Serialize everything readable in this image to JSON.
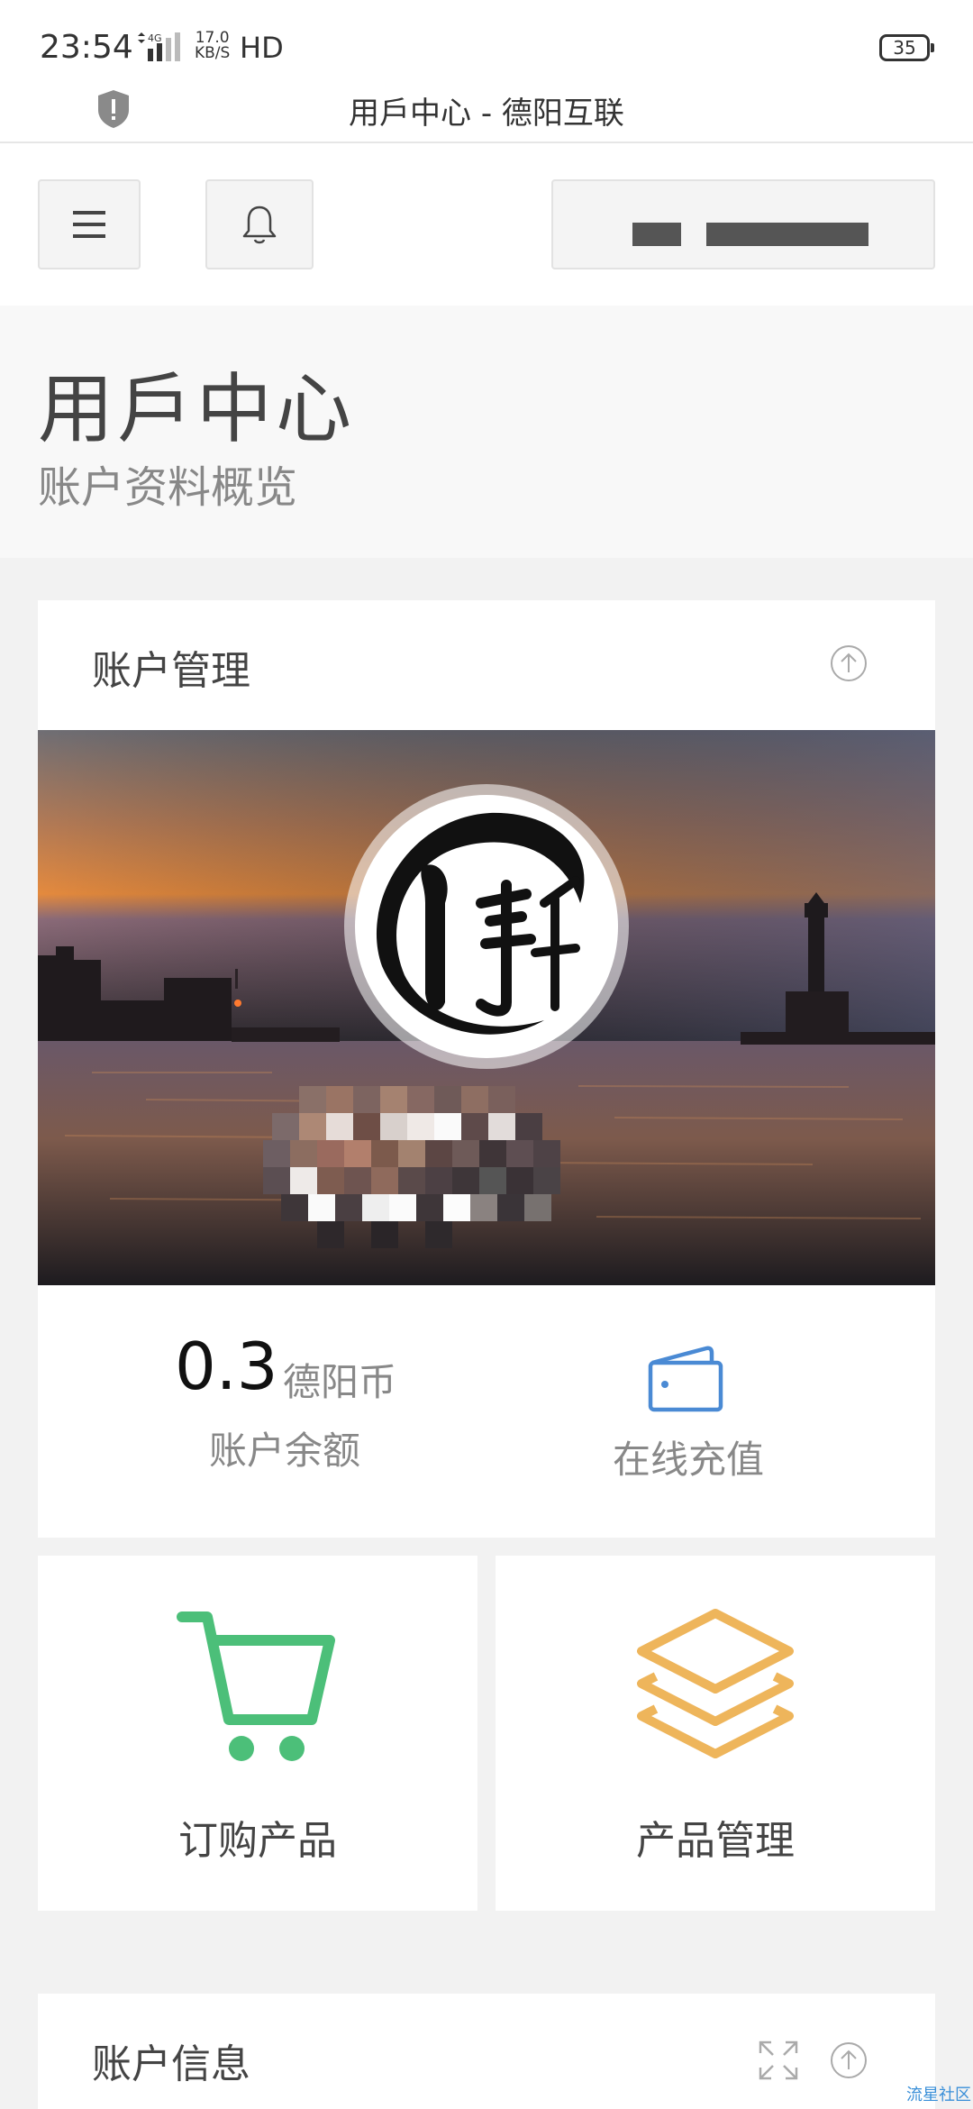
{
  "status_bar": {
    "time": "23:54",
    "network": "4G",
    "speed_value": "17.0",
    "speed_unit": "KB/S",
    "hd": "HD",
    "battery": "35"
  },
  "browser": {
    "title": "用戶中心 - 德阳互联"
  },
  "page": {
    "title": "用戶中心",
    "subtitle": "账户资料概览"
  },
  "account_card": {
    "title": "账户管理",
    "balance_value": "0.3",
    "balance_unit": "德阳币",
    "balance_label": "账户余额",
    "recharge_label": "在线充值"
  },
  "tiles": [
    {
      "label": "订购产品",
      "icon": "cart-icon",
      "color": "#4cbf79"
    },
    {
      "label": "产品管理",
      "icon": "layers-icon",
      "color": "#eeb55b"
    }
  ],
  "info_card": {
    "title": "账户信息"
  },
  "watermark": "流星社区",
  "colors": {
    "wallet": "#4a8ad4",
    "cart": "#4cbf79",
    "layers": "#eeb55b"
  }
}
